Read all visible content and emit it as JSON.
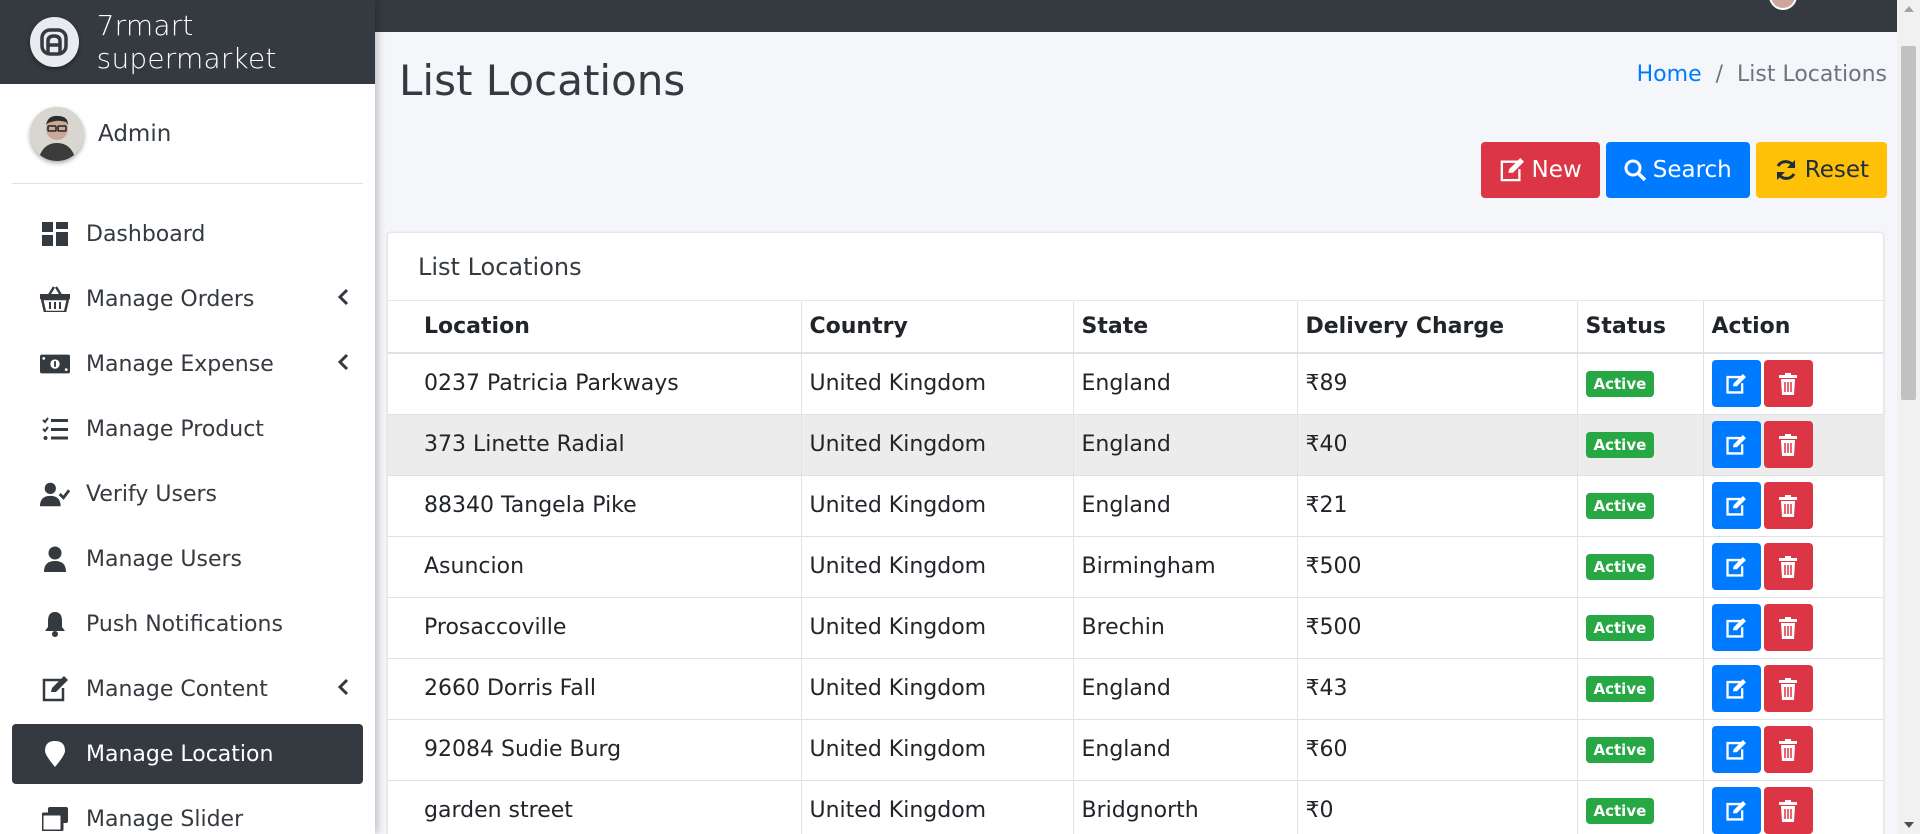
{
  "brand": {
    "name": "7rmart supermarket"
  },
  "user": {
    "name": "Admin"
  },
  "sidebar": {
    "items": [
      {
        "label": "Dashboard",
        "icon": "dashboard-icon",
        "has_chevron": false,
        "active": false
      },
      {
        "label": "Manage Orders",
        "icon": "basket-icon",
        "has_chevron": true,
        "active": false
      },
      {
        "label": "Manage Expense",
        "icon": "money-bill-icon",
        "has_chevron": true,
        "active": false
      },
      {
        "label": "Manage Product",
        "icon": "tasks-icon",
        "has_chevron": false,
        "active": false
      },
      {
        "label": "Verify Users",
        "icon": "user-check-icon",
        "has_chevron": false,
        "active": false
      },
      {
        "label": "Manage Users",
        "icon": "user-icon",
        "has_chevron": false,
        "active": false
      },
      {
        "label": "Push Notifications",
        "icon": "bell-icon",
        "has_chevron": false,
        "active": false
      },
      {
        "label": "Manage Content",
        "icon": "edit-icon",
        "has_chevron": true,
        "active": false
      },
      {
        "label": "Manage Location",
        "icon": "map-marker-icon",
        "has_chevron": false,
        "active": true
      },
      {
        "label": "Manage Slider",
        "icon": "window-restore-icon",
        "has_chevron": false,
        "active": false
      }
    ]
  },
  "page": {
    "title": "List Locations"
  },
  "breadcrumb": {
    "home": "Home",
    "separator": "/",
    "current": "List Locations"
  },
  "toolbar": {
    "new_label": "New",
    "search_label": "Search",
    "reset_label": "Reset"
  },
  "card": {
    "title": "List Locations"
  },
  "table": {
    "headers": [
      "Location",
      "Country",
      "State",
      "Delivery Charge",
      "Status",
      "Action"
    ],
    "rows": [
      {
        "location": "0237 Patricia Parkways",
        "country": "United Kingdom",
        "state": "England",
        "charge": "₹89",
        "status": "Active"
      },
      {
        "location": "373 Linette Radial",
        "country": "United Kingdom",
        "state": "England",
        "charge": "₹40",
        "status": "Active"
      },
      {
        "location": "88340 Tangela Pike",
        "country": "United Kingdom",
        "state": "England",
        "charge": "₹21",
        "status": "Active"
      },
      {
        "location": "Asuncion",
        "country": "United Kingdom",
        "state": "Birmingham",
        "charge": "₹500",
        "status": "Active"
      },
      {
        "location": "Prosaccoville",
        "country": "United Kingdom",
        "state": "Brechin",
        "charge": "₹500",
        "status": "Active"
      },
      {
        "location": "2660 Dorris Fall",
        "country": "United Kingdom",
        "state": "England",
        "charge": "₹43",
        "status": "Active"
      },
      {
        "location": "92084 Sudie Burg",
        "country": "United Kingdom",
        "state": "England",
        "charge": "₹60",
        "status": "Active"
      },
      {
        "location": "garden street",
        "country": "United Kingdom",
        "state": "Bridgnorth",
        "charge": "₹0",
        "status": "Active"
      }
    ]
  },
  "colors": {
    "sidebar_dark": "#343a40",
    "primary": "#007bff",
    "danger": "#dc3545",
    "warning": "#ffc107",
    "success": "#28a745"
  }
}
